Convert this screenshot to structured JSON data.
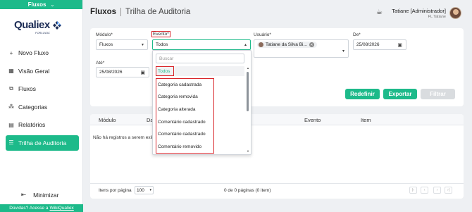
{
  "sidebar": {
    "module": "Fluxos",
    "logo": {
      "name": "Qualiex",
      "sub": "FORLOGIC"
    },
    "items": [
      {
        "label": "Novo Fluxo",
        "icon": "plus-icon"
      },
      {
        "label": "Visão Geral",
        "icon": "dashboard-icon"
      },
      {
        "label": "Fluxos",
        "icon": "flow-icon"
      },
      {
        "label": "Categorias",
        "icon": "categories-icon"
      },
      {
        "label": "Relatórios",
        "icon": "report-icon"
      },
      {
        "label": "Trilha de Auditoria",
        "icon": "audit-icon",
        "active": true
      }
    ],
    "minimize": "Minimizar",
    "wiki": {
      "prefix": "Dúvidas? Acesse a",
      "link": "WikiQualiex"
    }
  },
  "header": {
    "title": "Fluxos",
    "subtitle": "Trilha de Auditoria",
    "user_name": "Tatiane [Administrador]",
    "user_sub": "FL Tatiane"
  },
  "filters": {
    "modulo": {
      "label": "Módulo*",
      "value": "Fluxos"
    },
    "evento": {
      "label": "Evento*",
      "value": "Todos"
    },
    "usuario": {
      "label": "Usuário*",
      "value": "Tatiane da Silva Bi..."
    },
    "de": {
      "label": "De*",
      "value": "25/08/2026"
    },
    "ate": {
      "label": "Até*",
      "value": "25/08/2026"
    },
    "buttons": {
      "redefinir": "Redefinir",
      "exportar": "Exportar",
      "filtrar": "Filtrar"
    }
  },
  "dropdown": {
    "search_placeholder": "Buscar",
    "selected": "Todos",
    "options": [
      "Categoria cadastrada",
      "Categoria removida",
      "Categoria alterada",
      "Comentário cadastrado",
      "Comentário cadastrado",
      "Comentário removido"
    ]
  },
  "table": {
    "columns": [
      "Módulo",
      "Dat",
      "Evento",
      "Item"
    ],
    "empty_message": "Não há registros a serem exibi",
    "per_page_label": "Itens por página",
    "per_page_value": "100",
    "page_info": "0 de 0 páginas (0 item)"
  },
  "colors": {
    "accent": "#1dba8a",
    "highlight": "#d9262b"
  }
}
